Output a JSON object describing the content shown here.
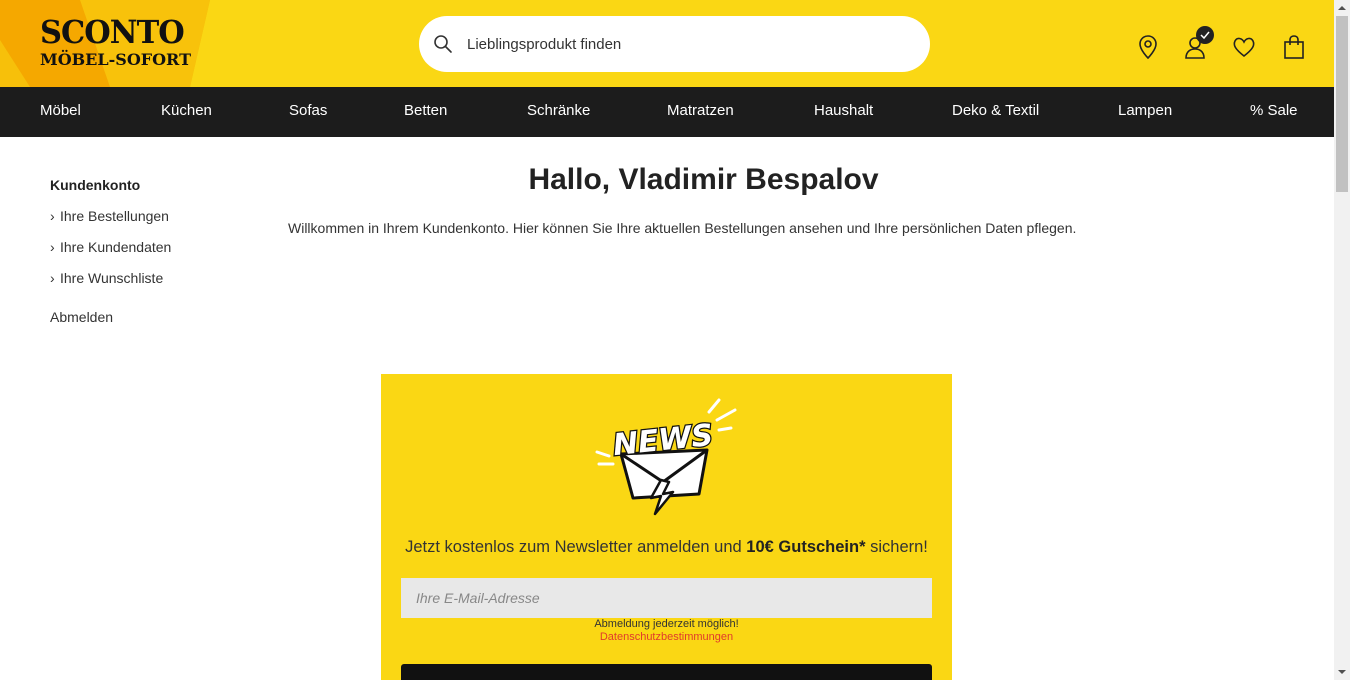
{
  "brand": {
    "line1": "SCONTO",
    "line2": "MÖBEL-SOFORT",
    "color_yellow": "#fad714",
    "color_orange": "#f5a800"
  },
  "search": {
    "placeholder": "Lieblingsprodukt finden"
  },
  "header_icons": [
    "location-pin-icon",
    "account-icon",
    "heart-icon",
    "shopping-bag-icon"
  ],
  "nav": {
    "items": [
      "Möbel",
      "Küchen",
      "Sofas",
      "Betten",
      "Schränke",
      "Matratzen",
      "Haushalt",
      "Deko & Textil",
      "Lampen",
      "% Sale"
    ]
  },
  "sidebar": {
    "title": "Kundenkonto",
    "links": [
      "Ihre Bestellungen",
      "Ihre Kundendaten",
      "Ihre Wunschliste"
    ],
    "logout": "Abmelden"
  },
  "main": {
    "greeting": "Hallo, Vladimir Bespalov",
    "welcome": "Willkommen in Ihrem Kundenkonto. Hier können Sie Ihre aktuellen Bestellungen ansehen und Ihre persönlichen Daten pflegen."
  },
  "newsletter": {
    "graphic_text": "NEWS",
    "text_before": "Jetzt kostenlos zum Newsletter anmelden und ",
    "text_bold": "10€ Gutschein*",
    "text_after": " sichern!",
    "email_placeholder": "Ihre E-Mail-Adresse",
    "unsubscribe_note": "Abmeldung jederzeit möglich!",
    "privacy_link": "Datenschutzbestimmungen"
  }
}
